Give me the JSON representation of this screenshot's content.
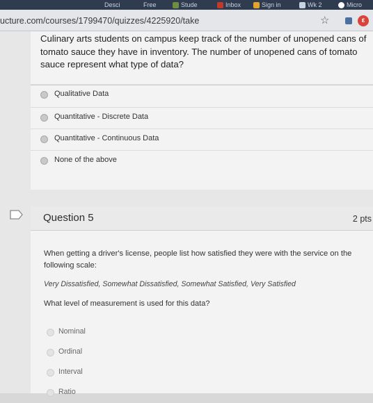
{
  "browser": {
    "tabs": [
      "Desci",
      "Free",
      "Stude",
      "Inbox",
      "Sign in",
      "Wk 2",
      "Micro"
    ],
    "url": "ucture.com/courses/1799470/quizzes/4225920/take"
  },
  "question4": {
    "text": "Culinary arts students on campus keep track of the number of unopened cans of tomato sauce they have in inventory. The number of unopened cans of tomato sauce represent what type of data?",
    "answers": [
      "Qualitative Data",
      "Quantitative - Discrete Data",
      "Quantitative - Continuous Data",
      "None of the above"
    ]
  },
  "question5": {
    "title": "Question 5",
    "points": "2 pts",
    "body": "When getting a driver's license, people list how satisfied they were with the service on the following scale:",
    "scale": "Very Dissatisfied, Somewhat Dissatisfied, Somewhat Satisfied, Very Satisfied",
    "ask": "What level of measurement is used for this data?",
    "answers": [
      "Nominal",
      "Ordinal",
      "Interval",
      "Ratio"
    ]
  },
  "colors": {
    "tabbar": "#2f3b4e",
    "page_bg": "#e7e7e7",
    "card_bg": "#f3f3f3"
  }
}
